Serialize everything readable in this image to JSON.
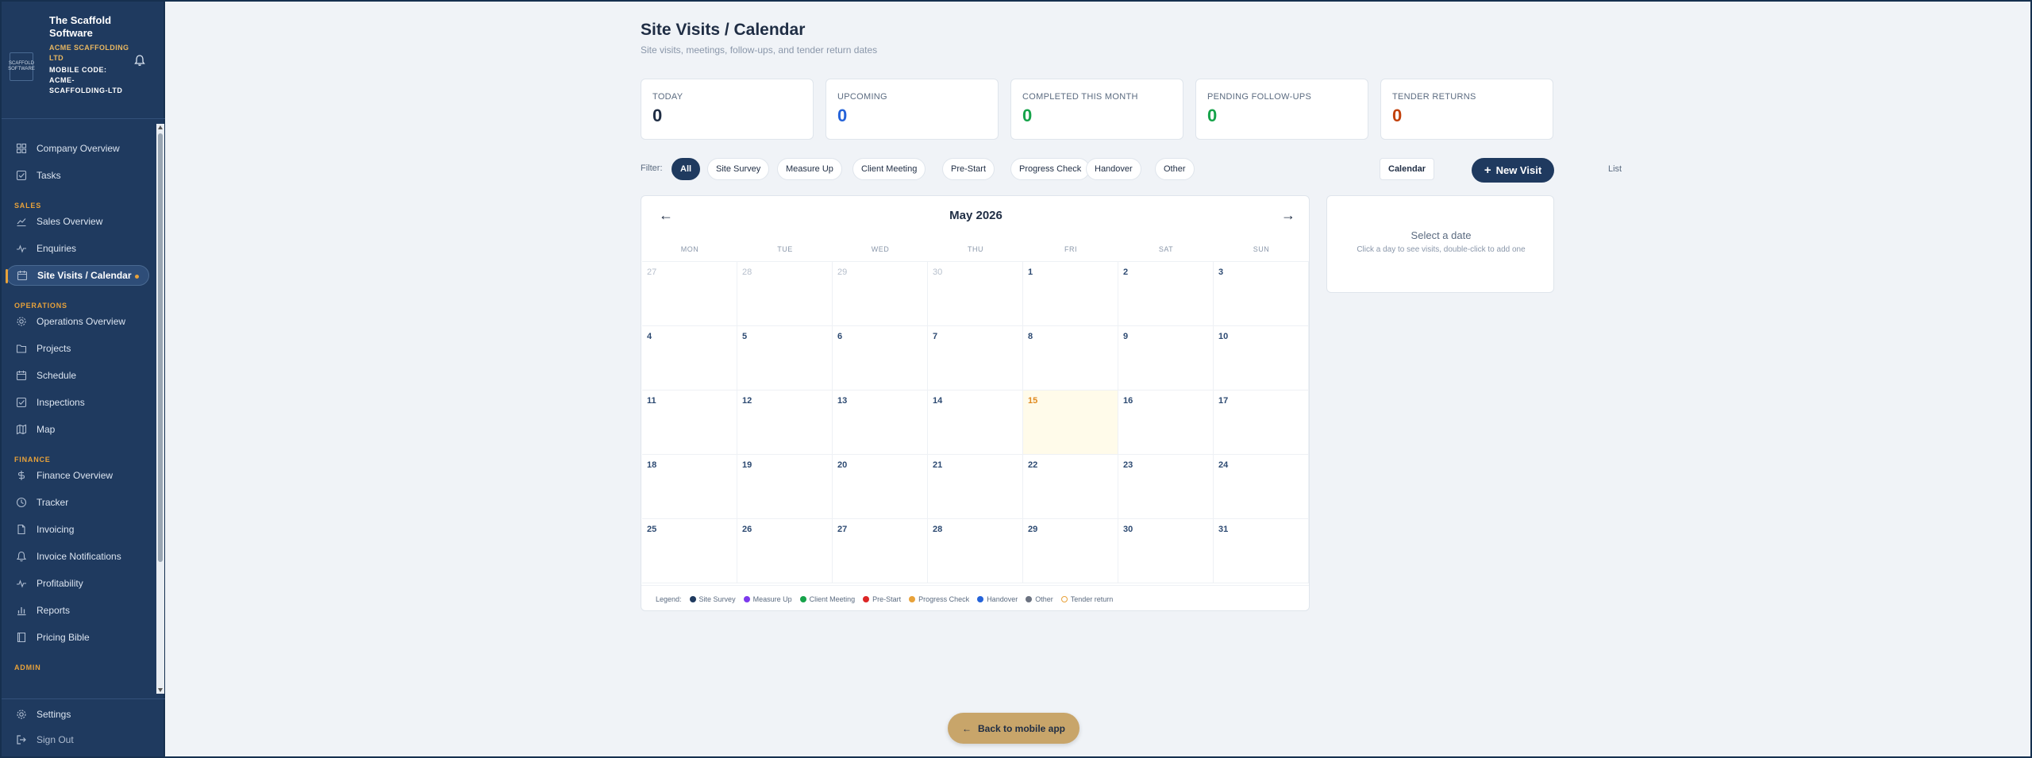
{
  "brand": {
    "logo_text": "SCAFFOLD SOFTWARE",
    "name": "The Scaffold Software",
    "company": "ACME SCAFFOLDING LTD",
    "mobile_code_label": "MOBILE CODE:",
    "mobile_code": "ACME-SCAFFOLDING-LTD"
  },
  "sidebar": {
    "items": [
      {
        "label": "Company Overview",
        "icon": "grid-icon"
      },
      {
        "label": "Tasks",
        "icon": "checkbox-icon"
      },
      {
        "section": "SALES"
      },
      {
        "label": "Sales Overview",
        "icon": "trend-icon"
      },
      {
        "label": "Enquiries",
        "icon": "activity-icon"
      },
      {
        "label": "Site Visits / Calendar",
        "icon": "calendar-icon",
        "active": true
      },
      {
        "section": "OPERATIONS"
      },
      {
        "label": "Operations Overview",
        "icon": "gear-icon"
      },
      {
        "label": "Projects",
        "icon": "folder-icon"
      },
      {
        "label": "Schedule",
        "icon": "calendar-icon"
      },
      {
        "label": "Inspections",
        "icon": "checkbox-icon"
      },
      {
        "label": "Map",
        "icon": "map-icon"
      },
      {
        "section": "FINANCE"
      },
      {
        "label": "Finance Overview",
        "icon": "dollar-icon"
      },
      {
        "label": "Tracker",
        "icon": "clock-icon"
      },
      {
        "label": "Invoicing",
        "icon": "file-icon"
      },
      {
        "label": "Invoice Notifications",
        "icon": "bell-icon"
      },
      {
        "label": "Profitability",
        "icon": "activity-icon"
      },
      {
        "label": "Reports",
        "icon": "bar-chart-icon"
      },
      {
        "label": "Pricing Bible",
        "icon": "book-icon"
      },
      {
        "section": "ADMIN"
      }
    ],
    "settings": "Settings",
    "sign_out": "Sign Out"
  },
  "header": {
    "title": "Site Visits / Calendar",
    "subtitle": "Site visits, meetings, follow-ups, and tender return dates"
  },
  "stats": [
    {
      "label": "TODAY",
      "value": "0",
      "color": "#1f2d44"
    },
    {
      "label": "UPCOMING",
      "value": "0",
      "color": "#2563d9"
    },
    {
      "label": "COMPLETED THIS MONTH",
      "value": "0",
      "color": "#16a34a"
    },
    {
      "label": "PENDING FOLLOW-UPS",
      "value": "0",
      "color": "#16a34a"
    },
    {
      "label": "TENDER RETURNS",
      "value": "0",
      "color": "#c2410c"
    }
  ],
  "filter": {
    "label": "Filter:",
    "chips": [
      "All",
      "Site Survey",
      "Measure Up",
      "Client Meeting",
      "Pre-Start",
      "Progress Check",
      "Handover",
      "Other"
    ],
    "active": "All"
  },
  "view": {
    "calendar": "Calendar",
    "list": "List",
    "active": "Calendar"
  },
  "new_visit": "New Visit",
  "calendar": {
    "month_label": "May 2026",
    "prev": "←",
    "next": "→",
    "weekdays": [
      "MON",
      "TUE",
      "WED",
      "THU",
      "FRI",
      "SAT",
      "SUN"
    ],
    "weeks": [
      [
        "27",
        "28",
        "29",
        "30",
        "1",
        "2",
        "3"
      ],
      [
        "4",
        "5",
        "6",
        "7",
        "8",
        "9",
        "10"
      ],
      [
        "11",
        "12",
        "13",
        "14",
        "15",
        "16",
        "17"
      ],
      [
        "18",
        "19",
        "20",
        "21",
        "22",
        "23",
        "24"
      ],
      [
        "25",
        "26",
        "27",
        "28",
        "29",
        "30",
        "31"
      ]
    ],
    "outside_count_first_week": 4,
    "today": "15"
  },
  "legend": {
    "title": "Legend:",
    "items": [
      {
        "label": "Site Survey",
        "color": "#1f3a5f"
      },
      {
        "label": "Measure Up",
        "color": "#7c3aed"
      },
      {
        "label": "Client Meeting",
        "color": "#16a34a"
      },
      {
        "label": "Pre-Start",
        "color": "#dc2626"
      },
      {
        "label": "Progress Check",
        "color": "#e8a23a"
      },
      {
        "label": "Handover",
        "color": "#2563d9"
      },
      {
        "label": "Other",
        "color": "#6b7280"
      },
      {
        "label": "Tender return",
        "color": "#e8a23a",
        "ring": true
      }
    ]
  },
  "side_panel": {
    "heading": "Select a date",
    "hint": "Click a day to see visits, double-click to add one"
  },
  "back_button": "Back to mobile app"
}
